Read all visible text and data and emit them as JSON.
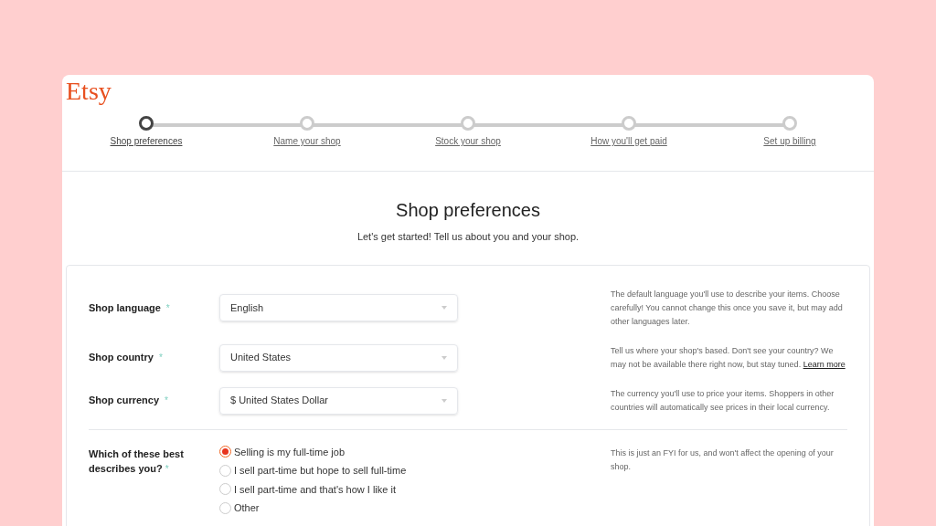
{
  "logo": "Etsy",
  "steps": [
    {
      "label": "Shop preferences",
      "selected": true
    },
    {
      "label": "Name your shop",
      "selected": false
    },
    {
      "label": "Stock your shop",
      "selected": false
    },
    {
      "label": "How you'll get paid",
      "selected": false
    },
    {
      "label": "Set up billing",
      "selected": false
    }
  ],
  "heading": "Shop preferences",
  "subheading": "Let's get started! Tell us about you and your shop.",
  "fields": [
    {
      "label": "Shop language",
      "required_mark": "*",
      "value": "English",
      "help": "The default language you'll use to describe your items. Choose carefully! You cannot change this once you save it, but may add other languages later."
    },
    {
      "label": "Shop country",
      "required_mark": "*",
      "value": "United States",
      "help": "Tell us where your shop's based. Don't see your country? We may not be available there right now, but stay tuned.",
      "help_link": "Learn more"
    },
    {
      "label": "Shop currency",
      "required_mark": "*",
      "value": "$ United States Dollar",
      "help": "The currency you'll use to price your items. Shoppers in other countries will automatically see prices in their local currency."
    }
  ],
  "question": {
    "label": "Which of these best describes you?",
    "required_mark": "*",
    "help": "This is just an FYI for us, and won't affect the opening of your shop.",
    "options": [
      {
        "label": "Selling is my full-time job",
        "selected": true
      },
      {
        "label": "I sell part-time but hope to sell full-time",
        "selected": false
      },
      {
        "label": "I sell part-time and that's how I like it",
        "selected": false
      },
      {
        "label": "Other",
        "selected": false
      }
    ]
  }
}
